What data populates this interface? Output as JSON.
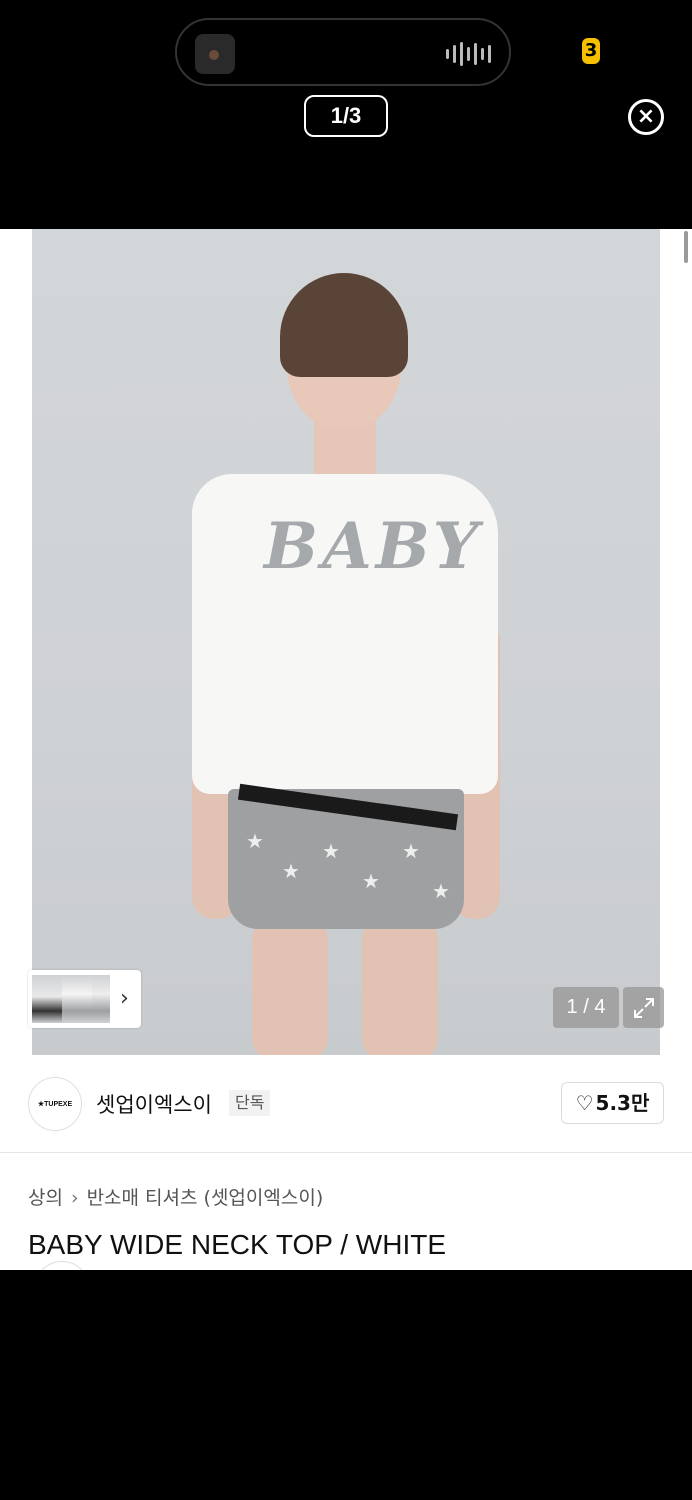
{
  "viewer": {
    "page_counter": "1/3",
    "close_icon": "close-circle-icon",
    "badge_text": "3"
  },
  "product": {
    "image_counter": "1 / 4",
    "shirt_print": "BABY",
    "thumb_arrow": "›",
    "expand_icon": "expand-icon"
  },
  "brand": {
    "logo_text": "★TUPEXE",
    "name": "셋업이엑스이",
    "tag": "단독",
    "likes": "5.3만"
  },
  "breadcrumb": {
    "category": "상의",
    "sub_category": "반소매 티셔츠 (셋업이엑스이)"
  },
  "title": "BABY WIDE NECK TOP / WHITE"
}
